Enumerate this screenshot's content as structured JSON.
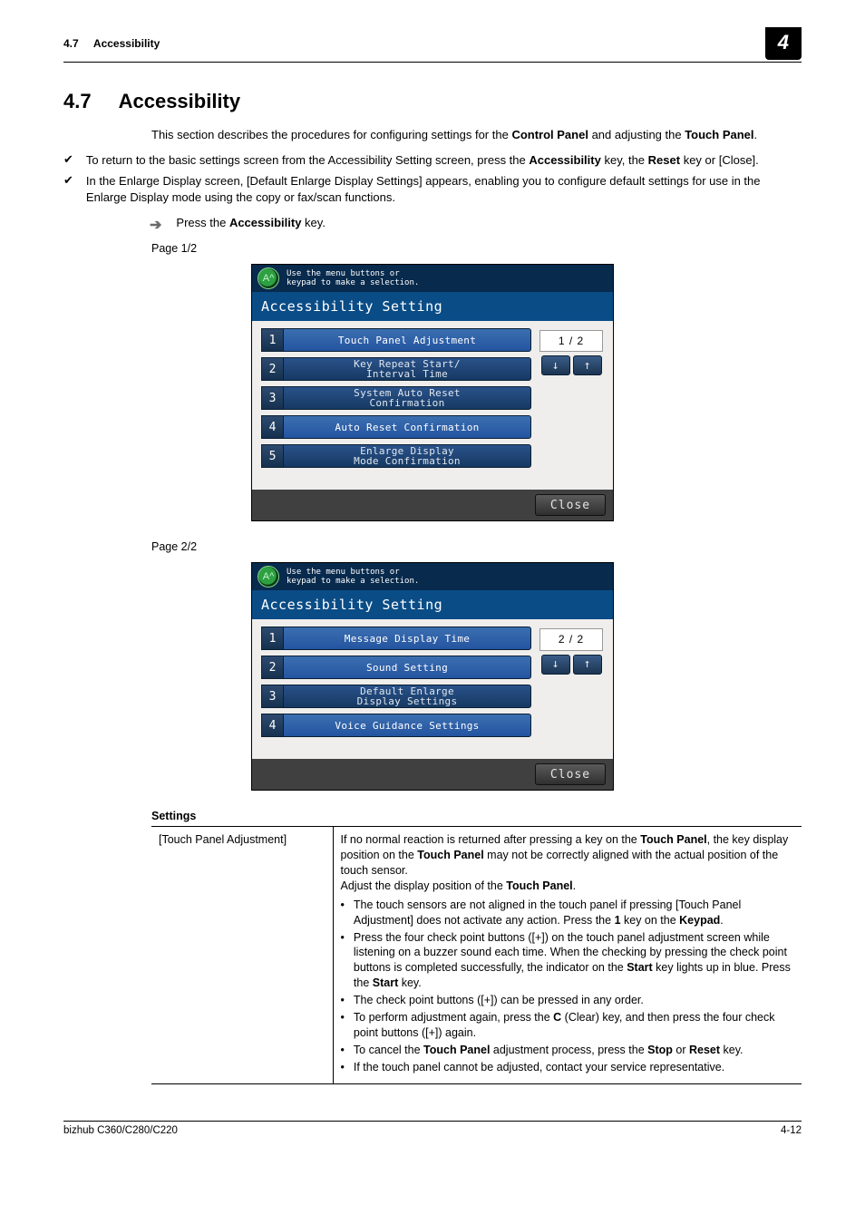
{
  "header": {
    "section_ref": "4.7",
    "section_name": "Accessibility",
    "chapter_tab": "4"
  },
  "section": {
    "num": "4.7",
    "title": "Accessibility"
  },
  "intro": {
    "p1_a": "This section describes the procedures for configuring settings for the ",
    "p1_b": "Control Panel",
    "p1_c": " and adjusting the ",
    "p1_d": "Touch Panel",
    "p1_e": "."
  },
  "checks": {
    "c1_a": "To return to the basic settings screen from the Accessibility Setting screen, press the ",
    "c1_b": "Accessibility",
    "c1_c": " key, the ",
    "c1_d": "Reset",
    "c1_e": " key or [Close].",
    "c2": "In the Enlarge Display screen, [Default Enlarge Display Settings] appears, enabling you to configure default settings for use in the Enlarge Display mode using the copy or fax/scan functions."
  },
  "step": {
    "a": "Press the ",
    "b": "Accessibility",
    "c": " key."
  },
  "page_labels": {
    "p1": "Page 1/2",
    "p2": "Page 2/2"
  },
  "screenshot_common": {
    "hint": "Use the menu buttons or\nkeypad to make a selection.",
    "hint_icon": "A^",
    "title": "Accessibility Setting",
    "close": "Close"
  },
  "ss1": {
    "items": [
      {
        "n": "1",
        "label": "Touch Panel Adjustment",
        "highlight": true
      },
      {
        "n": "2",
        "label": "Key Repeat Start/\nInterval Time"
      },
      {
        "n": "3",
        "label": "System Auto Reset\nConfirmation"
      },
      {
        "n": "4",
        "label": "Auto Reset Confirmation",
        "highlight": true
      },
      {
        "n": "5",
        "label": "Enlarge Display\nMode Confirmation"
      }
    ],
    "pager": "1 / 2"
  },
  "ss2": {
    "items": [
      {
        "n": "1",
        "label": "Message Display Time",
        "highlight": true
      },
      {
        "n": "2",
        "label": "Sound Setting",
        "highlight": true
      },
      {
        "n": "3",
        "label": "Default Enlarge\nDisplay Settings"
      },
      {
        "n": "4",
        "label": "Voice Guidance Settings",
        "highlight": true
      }
    ],
    "pager": "2 / 2"
  },
  "settings": {
    "heading": "Settings",
    "rows": [
      {
        "name": "[Touch Panel Adjustment]",
        "p1_a": "If no normal reaction is returned after pressing a key on the ",
        "p1_b": "Touch Panel",
        "p1_c": ", the key display position on the ",
        "p1_d": "Touch Panel",
        "p1_e": " may not be correctly aligned with the actual position of the touch sensor.",
        "p2_a": "Adjust the display position of the ",
        "p2_b": "Touch Panel",
        "p2_c": ".",
        "bullets": [
          {
            "a": "The touch sensors are not aligned in the touch panel if pressing [Touch Panel Adjustment] does not activate any action. Press the ",
            "b": "1",
            "c": " key on the ",
            "d": "Keypad",
            "e": "."
          },
          {
            "a": "Press the four check point buttons ([+]) on the touch panel adjustment screen while listening on a buzzer sound each time. When the checking by pressing the check point buttons is completed successfully, the indicator on the ",
            "b": "Start",
            "c": " key lights up in blue. Press the ",
            "d": "Start",
            "e": " key."
          },
          {
            "a": "The check point buttons ([+]) can be pressed in any order."
          },
          {
            "a": "To perform adjustment again, press the ",
            "b": "C",
            "c": " (Clear) key, and then press the four check point buttons ([+]) again."
          },
          {
            "a": "To cancel the ",
            "b": "Touch Panel",
            "c": " adjustment process, press the ",
            "d": "Stop",
            "e": " or ",
            "f": "Reset",
            "g": " key."
          },
          {
            "a": "If the touch panel cannot be adjusted, contact your service representative."
          }
        ]
      }
    ]
  },
  "footer": {
    "model": "bizhub C360/C280/C220",
    "page": "4-12"
  }
}
